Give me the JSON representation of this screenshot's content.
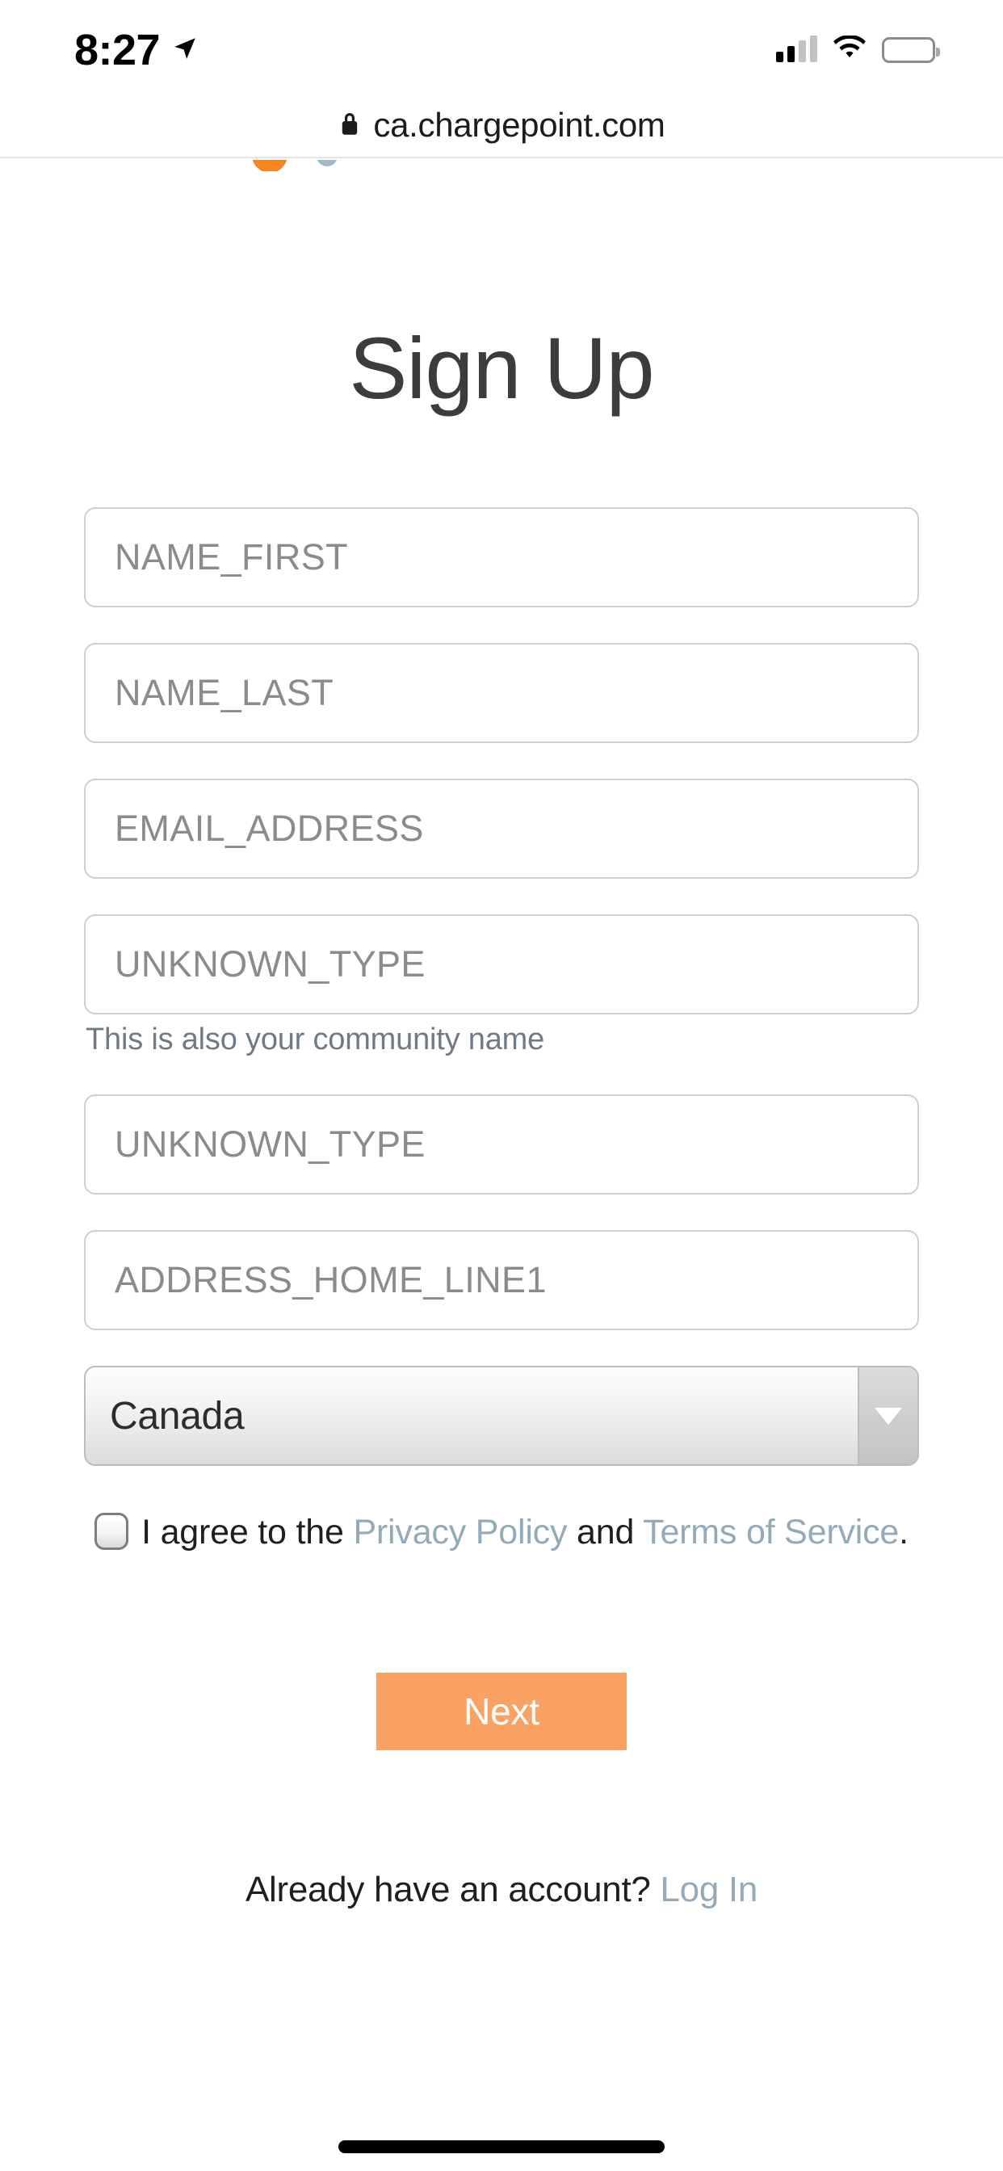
{
  "status_bar": {
    "time": "8:27",
    "location_icon": "location-arrow-icon",
    "cellular_icon": "cellular-signal-icon",
    "wifi_icon": "wifi-icon",
    "battery_icon": "battery-icon"
  },
  "browser": {
    "lock_icon": "lock-icon",
    "url": "ca.chargepoint.com"
  },
  "brand": {
    "logo_orange": "#F6861F",
    "logo_blue": "#9fb9c9"
  },
  "page": {
    "title": "Sign Up"
  },
  "form": {
    "fields": [
      {
        "name": "first-name",
        "placeholder": "NAME_FIRST",
        "value": ""
      },
      {
        "name": "last-name",
        "placeholder": "NAME_LAST",
        "value": ""
      },
      {
        "name": "email",
        "placeholder": "EMAIL_ADDRESS",
        "value": ""
      },
      {
        "name": "username",
        "placeholder": "UNKNOWN_TYPE",
        "value": ""
      },
      {
        "name": "password",
        "placeholder": "UNKNOWN_TYPE",
        "value": ""
      },
      {
        "name": "address-line1",
        "placeholder": "ADDRESS_HOME_LINE1",
        "value": ""
      }
    ],
    "helper_text": "This is also your community name",
    "country": {
      "label": "country-select",
      "selected": "Canada",
      "caret_icon": "chevron-down-icon"
    }
  },
  "agreement": {
    "checked": false,
    "prefix": "I agree to the ",
    "privacy_link": "Privacy Policy",
    "conjunction": " and ",
    "terms_link": "Terms of Service",
    "suffix": "."
  },
  "actions": {
    "next_label": "Next",
    "next_color": "#F9A264"
  },
  "footer": {
    "text": "Already have an account? ",
    "login_link": "Log In",
    "link_color": "#93aab9"
  }
}
